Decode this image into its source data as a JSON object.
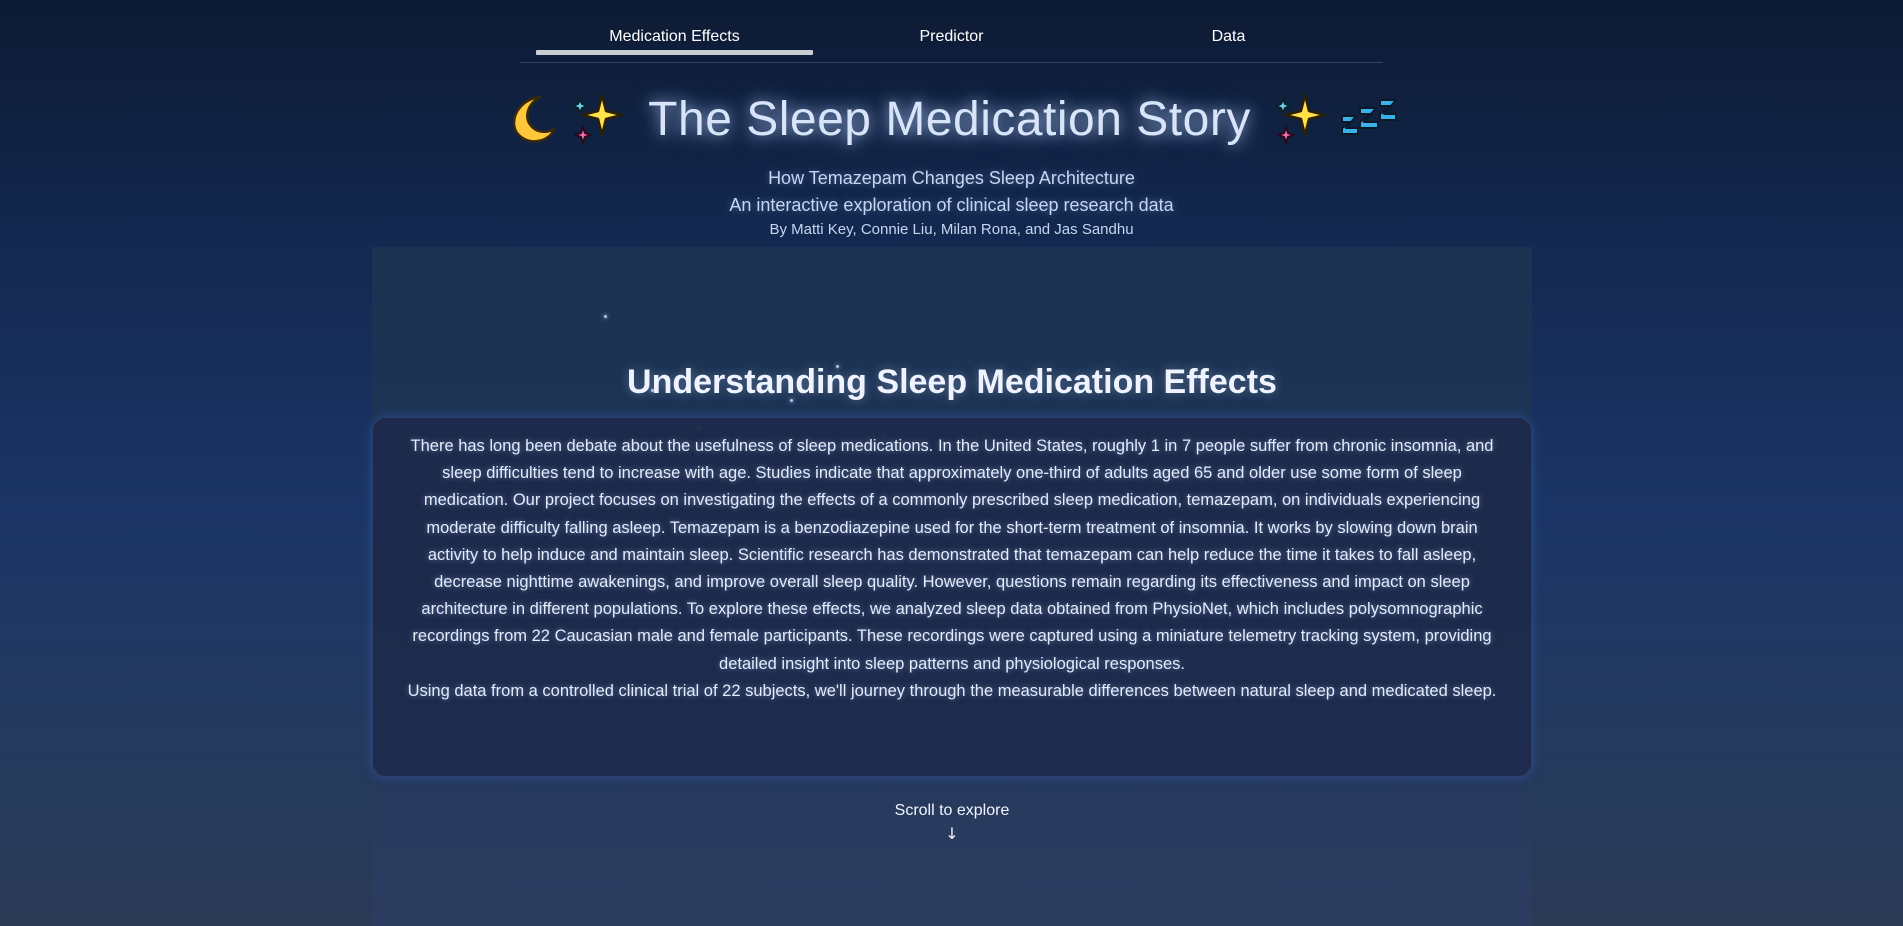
{
  "nav": {
    "tabs": [
      {
        "label": "Medication Effects",
        "active": true
      },
      {
        "label": "Predictor",
        "active": false
      },
      {
        "label": "Data",
        "active": false
      }
    ]
  },
  "header": {
    "icons": [
      "crescent-moon",
      "sparkles",
      "sparkles",
      "zzz"
    ],
    "title": "The Sleep Medication Story",
    "subtitle": "How Temazepam Changes Sleep Architecture",
    "tagline": "An interactive exploration of clinical sleep research data",
    "authors": "By Matti Key, Connie Liu, Milan Rona, and Jas Sandhu"
  },
  "main": {
    "section_title": "Understanding Sleep Medication Effects",
    "intro_paragraph_1": "There has long been debate about the usefulness of sleep medications. In the United States, roughly 1 in 7 people suffer from chronic insomnia, and sleep difficulties tend to increase with age. Studies indicate that approximately one-third of adults aged 65 and older use some form of sleep medication. Our project focuses on investigating the effects of a commonly prescribed sleep medication, temazepam, on individuals experiencing moderate difficulty falling asleep. Temazepam is a benzodiazepine used for the short-term treatment of insomnia. It works by slowing down brain activity to help induce and maintain sleep. Scientific research has demonstrated that temazepam can help reduce the time it takes to fall asleep, decrease nighttime awakenings, and improve overall sleep quality. However, questions remain regarding its effectiveness and impact on sleep architecture in different populations. To explore these effects, we analyzed sleep data obtained from PhysioNet, which includes polysomnographic recordings from 22 Caucasian male and female participants. These recordings were captured using a miniature telemetry tracking system, providing detailed insight into sleep patterns and physiological responses.",
    "intro_paragraph_2": "Using data from a controlled clinical trial of 22 subjects, we'll journey through the measurable differences between natural sleep and medicated sleep.",
    "scroll_hint": "Scroll to explore",
    "scroll_arrow": "↓"
  },
  "colors": {
    "background_top": "#0d1a33",
    "background_bottom": "#2b3a55",
    "card": "#1d2a4b",
    "active_tab_underline": "#c9ccd3",
    "title_glow": "#bed7ff"
  }
}
